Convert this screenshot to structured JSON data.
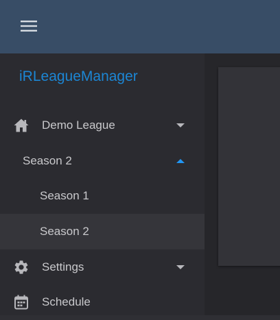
{
  "app": {
    "brand": "iRLeagueManager"
  },
  "nav": {
    "league": {
      "label": "Demo League",
      "icon": "home-icon",
      "expanded": false
    },
    "season_group": {
      "label": "Season 2",
      "expanded": true
    },
    "seasons": [
      {
        "label": "Season 1",
        "selected": false
      },
      {
        "label": "Season 2",
        "selected": true
      }
    ],
    "settings": {
      "label": "Settings",
      "icon": "gear-icon",
      "expanded": false
    },
    "schedule": {
      "label": "Schedule",
      "icon": "calendar-icon"
    }
  },
  "colors": {
    "appbar": "#384d66",
    "brand": "#1c86d4",
    "accent": "#1c86d4",
    "text": "#c9c9cc"
  }
}
